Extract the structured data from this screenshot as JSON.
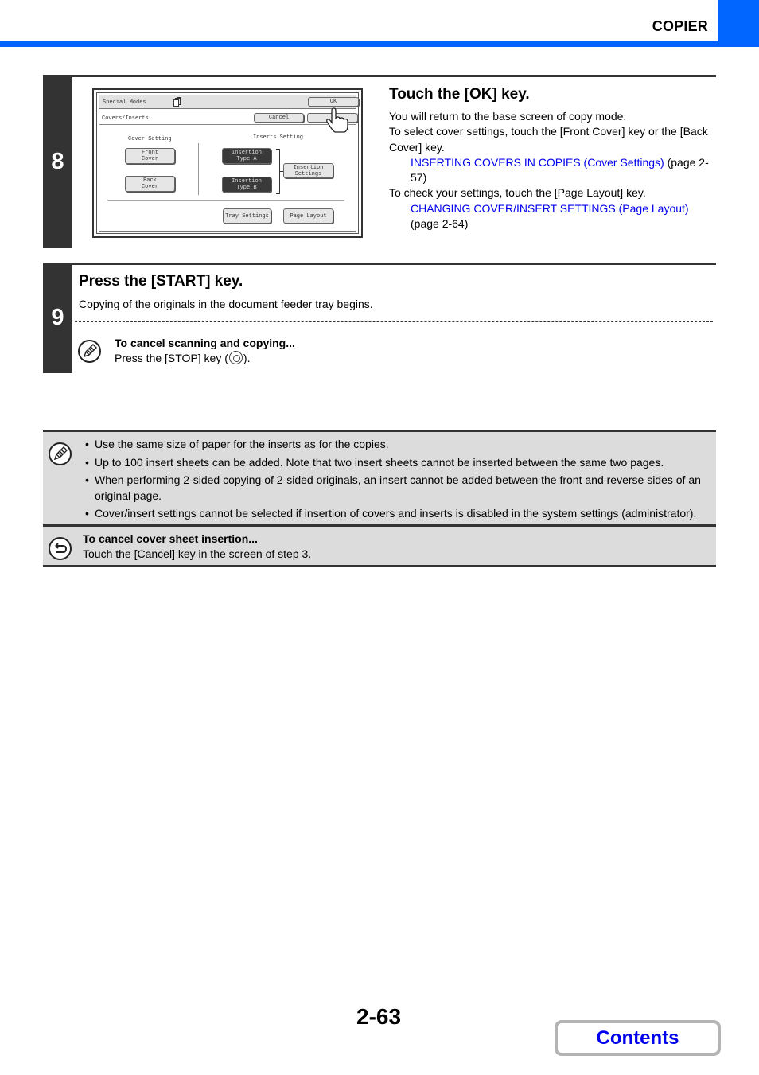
{
  "header": {
    "section_title": "COPIER",
    "accent_color": "#0066ff"
  },
  "step8": {
    "number": "8",
    "title": "Touch the [OK] key.",
    "lines": [
      "You will return to the base screen of copy mode.",
      "To select cover settings, touch the [Front Cover] key or the [Back Cover] key."
    ],
    "link1": {
      "text": "INSERTING COVERS IN COPIES (Cover Settings)",
      "suffix": " (page 2-57)"
    },
    "line3": "To check your settings, touch the [Page Layout] key.",
    "link2": {
      "text": "CHANGING COVER/INSERT SETTINGS (Page Layout)",
      "suffix": " (page 2-64)"
    },
    "screen": {
      "top_bar_label": "Special Modes",
      "ok_button": "OK",
      "sub_label": "Covers/Inserts",
      "cancel_button": "Cancel",
      "cover_setting_label": "Cover Setting",
      "inserts_setting_label": "Inserts Setting",
      "front_cover_button": "Front\nCover",
      "back_cover_button": "Back\nCover",
      "insertion_type_a_button": "Insertion\nType A",
      "insertion_type_b_button": "Insertion\nType B",
      "insertion_settings_button": "Insertion\nSettings",
      "tray_settings_button": "Tray Settings",
      "page_layout_button": "Page Layout"
    }
  },
  "step9": {
    "number": "9",
    "title": "Press the [START] key.",
    "intro": "Copying of the originals in the document feeder tray begins.",
    "tip_title": "To cancel scanning and copying...",
    "tip_text_before": "Press the [STOP] key (",
    "tip_text_after": ")."
  },
  "notes": {
    "items": [
      "Use the same size of paper for the inserts as for the copies.",
      "Up to 100 insert sheets can be added. Note that two insert sheets cannot be inserted between the same two pages.",
      "When performing 2-sided copying of 2-sided originals, an insert cannot be added between the front and reverse sides of an original page.",
      "Cover/insert settings cannot be selected if insertion of covers and inserts is disabled in the system settings (administrator)."
    ]
  },
  "cancel_note": {
    "title": "To cancel cover sheet insertion...",
    "text": "Touch the [Cancel] key in the screen of step 3."
  },
  "footer": {
    "page_number": "2-63",
    "contents_button": "Contents"
  }
}
